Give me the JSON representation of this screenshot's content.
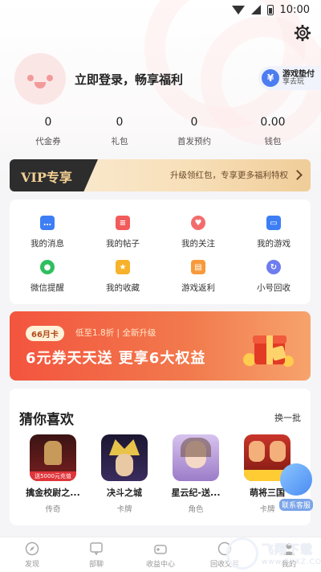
{
  "status_bar": {
    "time": "10:00"
  },
  "profile": {
    "login_prompt": "立即登录，畅享福利",
    "pay_badge": {
      "coin_symbol": "¥",
      "title": "游戏垫付",
      "subtitle": "享去玩"
    }
  },
  "stats": [
    {
      "value": "0",
      "label": "代金券"
    },
    {
      "value": "0",
      "label": "礼包"
    },
    {
      "value": "0",
      "label": "首发预约"
    },
    {
      "value": "0.00",
      "label": "钱包"
    }
  ],
  "vip": {
    "title": "VIP专享",
    "desc": "升级领红包，专享更多福利特权"
  },
  "menu": [
    {
      "label": "我的消息",
      "icon": "message-icon",
      "color": "#3d7ef5"
    },
    {
      "label": "我的帖子",
      "icon": "post-icon",
      "color": "#f25b5b"
    },
    {
      "label": "我的关注",
      "icon": "heart-icon",
      "color": "#f36c6c"
    },
    {
      "label": "我的游戏",
      "icon": "game-icon",
      "color": "#3d7ef5"
    },
    {
      "label": "微信提醒",
      "icon": "wechat-icon",
      "color": "#2fbf5f"
    },
    {
      "label": "我的收藏",
      "icon": "star-icon",
      "color": "#f7b12b"
    },
    {
      "label": "游戏返利",
      "icon": "rebate-icon",
      "color": "#f79a3b"
    },
    {
      "label": "小号回收",
      "icon": "recycle-icon",
      "color": "#6d7cf0"
    }
  ],
  "banner": {
    "tag": "66月卡",
    "subtitle": "低至1.8折 | 全新升级",
    "headline": "6元券天天送 更享6大权益"
  },
  "recommend": {
    "title": "猜你喜欢",
    "refresh_label": "换一批",
    "games": [
      {
        "name": "擒金校尉之...",
        "category": "传奇",
        "icon": "legend-game-icon",
        "color": "#5a1b1b",
        "badge": "送5000元充值"
      },
      {
        "name": "决斗之城",
        "category": "卡牌",
        "icon": "duel-game-icon",
        "color": "#2a2240"
      },
      {
        "name": "星云纪-送...",
        "category": "角色",
        "icon": "nebula-game-icon",
        "color": "#b59bd6"
      },
      {
        "name": "萌将三国",
        "category": "卡牌",
        "icon": "sanguo-game-icon",
        "color": "#b5281f"
      }
    ]
  },
  "service": {
    "label": "联系客服"
  },
  "bottom_nav": [
    {
      "label": "发现",
      "icon": "discover-icon"
    },
    {
      "label": "部聊",
      "icon": "chat-icon"
    },
    {
      "label": "收益中心",
      "icon": "earnings-icon"
    },
    {
      "label": "回收交易",
      "icon": "trade-icon"
    },
    {
      "label": "我的",
      "icon": "profile-icon"
    }
  ],
  "watermark": {
    "brand": "飞翔下载",
    "url": "www.FXXZ.COM"
  }
}
